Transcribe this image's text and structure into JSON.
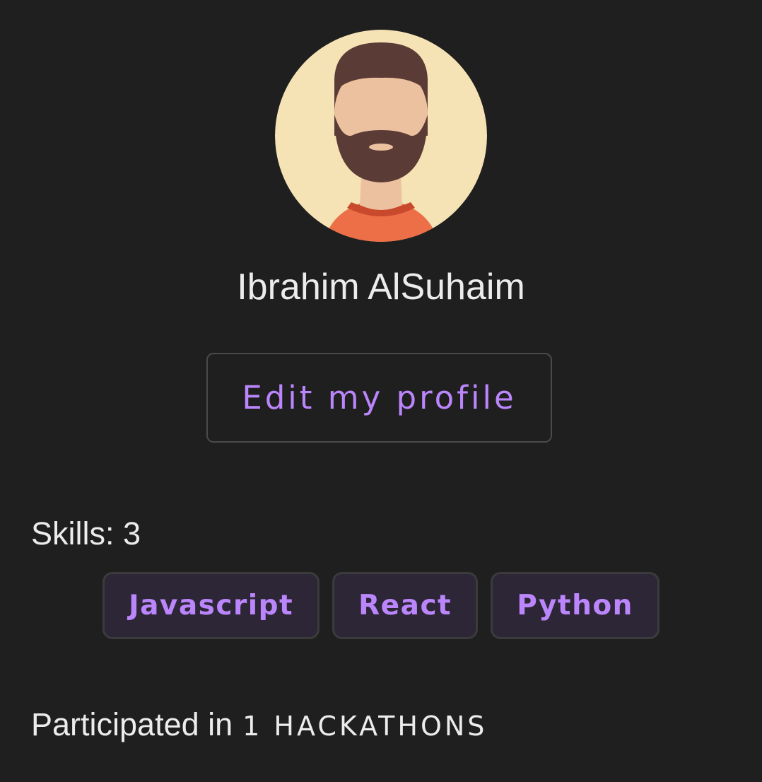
{
  "profile": {
    "name": "Ibrahim AlSuhaim",
    "avatar_icon": "bearded-man-avatar-icon",
    "edit_button_label": "Edit my profile"
  },
  "skills": {
    "heading": "Skills: 3",
    "items": [
      {
        "label": "Javascript"
      },
      {
        "label": "React"
      },
      {
        "label": "Python"
      }
    ]
  },
  "participation": {
    "prefix": "Participated in",
    "count_text": "1 HACKATHONS"
  },
  "colors": {
    "background": "#1f1f1f",
    "accent": "#bb86fc",
    "chip_background": "#2d2637",
    "text": "#ececec"
  }
}
